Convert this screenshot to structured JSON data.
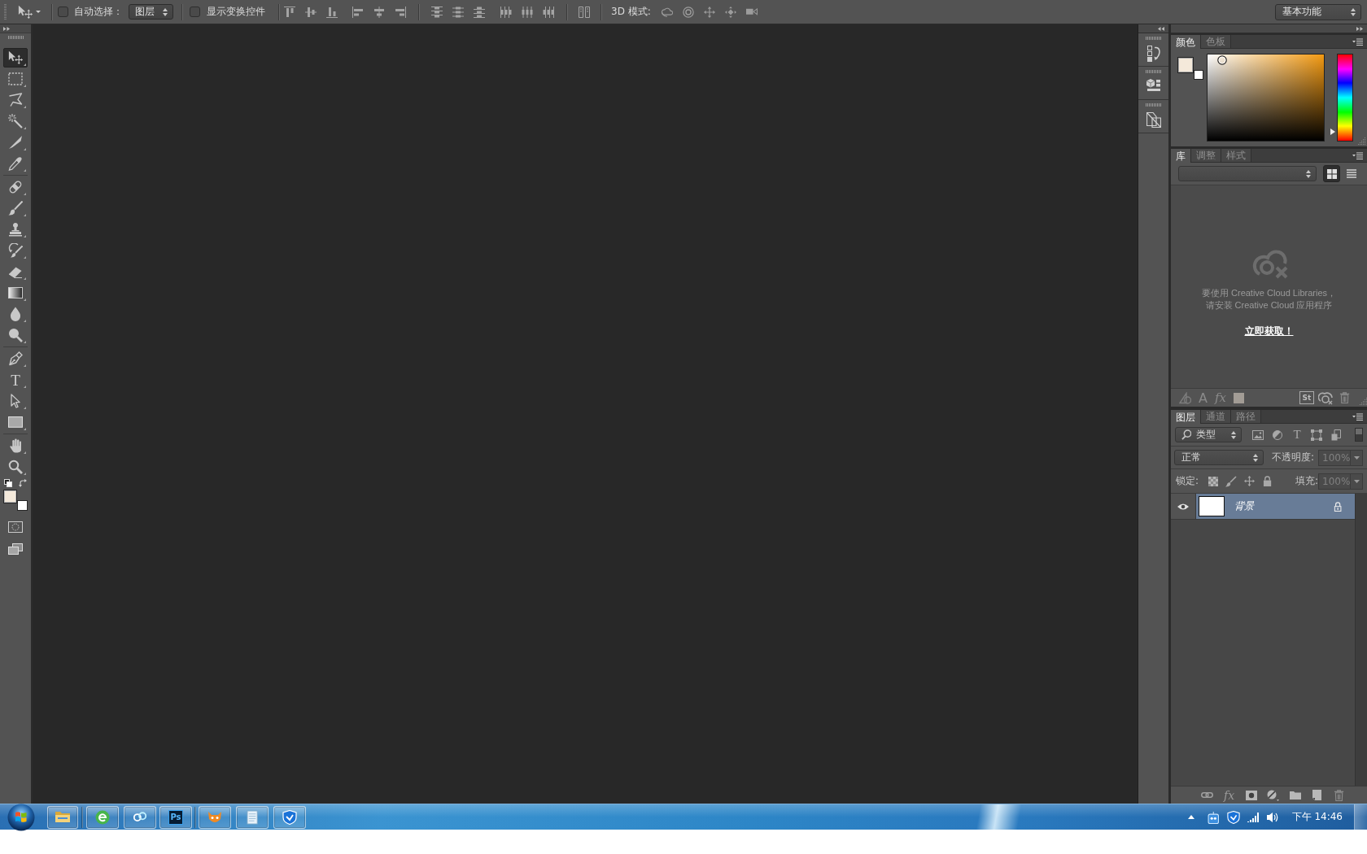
{
  "options_bar": {
    "auto_select": {
      "label": "自动选择：",
      "checked": false
    },
    "auto_select_target": "图层",
    "show_transform_controls": {
      "label": "显示变换控件",
      "checked": false
    },
    "mode_3d_label": "3D 模式:",
    "workspace": "基本功能"
  },
  "toolbar": {
    "tool_groups": [
      {
        "tools": [
          {
            "kind": "move",
            "selected": true
          },
          {
            "kind": "marquee",
            "selected": false
          },
          {
            "kind": "lasso",
            "selected": false
          },
          {
            "kind": "magic_wand",
            "selected": false
          },
          {
            "kind": "slice",
            "selected": false
          },
          {
            "kind": "eyedropper",
            "selected": false
          }
        ]
      },
      {
        "tools": [
          {
            "kind": "healing",
            "selected": false
          },
          {
            "kind": "brush",
            "selected": false
          },
          {
            "kind": "stamp",
            "selected": false
          },
          {
            "kind": "history_brush",
            "selected": false
          },
          {
            "kind": "eraser",
            "selected": false
          },
          {
            "kind": "gradient",
            "selected": false
          },
          {
            "kind": "blur",
            "selected": false
          },
          {
            "kind": "dodge",
            "selected": false
          }
        ]
      },
      {
        "tools": [
          {
            "kind": "pen",
            "selected": false
          },
          {
            "kind": "type",
            "glyph": "T",
            "selected": false
          },
          {
            "kind": "path_select",
            "selected": false
          },
          {
            "kind": "shape",
            "selected": false
          }
        ]
      },
      {
        "tools": [
          {
            "kind": "hand",
            "selected": false
          },
          {
            "kind": "zoom",
            "selected": false
          }
        ]
      }
    ],
    "swatches": [
      {
        "kind": "foreground",
        "color": "#f4e9da"
      },
      {
        "kind": "background",
        "color": "#ffffff"
      }
    ]
  },
  "color_panel": {
    "tabs": [
      {
        "label": "颜色",
        "selected": true
      },
      {
        "label": "色板",
        "selected": false
      }
    ],
    "swatches": [
      {
        "kind": "foreground",
        "color": "#f4e9da"
      },
      {
        "kind": "background",
        "color": "#ffffff"
      }
    ],
    "hue_slider": {
      "level": 0.1
    }
  },
  "library_panel": {
    "tabs": [
      {
        "label": "库",
        "selected": true
      },
      {
        "label": "调整",
        "selected": false
      },
      {
        "label": "样式",
        "selected": false
      }
    ],
    "view_modes": [
      {
        "kind": "grid",
        "selected": true
      },
      {
        "kind": "list",
        "selected": false
      }
    ],
    "message_lines": [
      "要使用 Creative Cloud Libraries，",
      "请安装 Creative Cloud 应用程序"
    ],
    "link": "立即获取！",
    "footer_glyphs": {
      "text": "A",
      "effects": "fx",
      "stock": "St"
    }
  },
  "layers_panel": {
    "tabs": [
      {
        "label": "图层",
        "selected": true
      },
      {
        "label": "通道",
        "selected": false
      },
      {
        "label": "路径",
        "selected": false
      }
    ],
    "filter": {
      "value": "类型",
      "enabled": false
    },
    "type_filter_glyph": "T",
    "blend_mode": "正常",
    "opacity": {
      "label": "不透明度:",
      "value": "100%",
      "disabled": true
    },
    "lock_label": "锁定:",
    "fill": {
      "label": "填充:",
      "value": "100%",
      "disabled": true
    },
    "layers": [
      {
        "name": "背景",
        "visible": true,
        "locked": true,
        "selected": true
      }
    ],
    "footer_glyphs": {
      "effects": "fx"
    }
  },
  "taskbar": {
    "app_tile_text": "Ps",
    "clock": "下午 14:46"
  }
}
